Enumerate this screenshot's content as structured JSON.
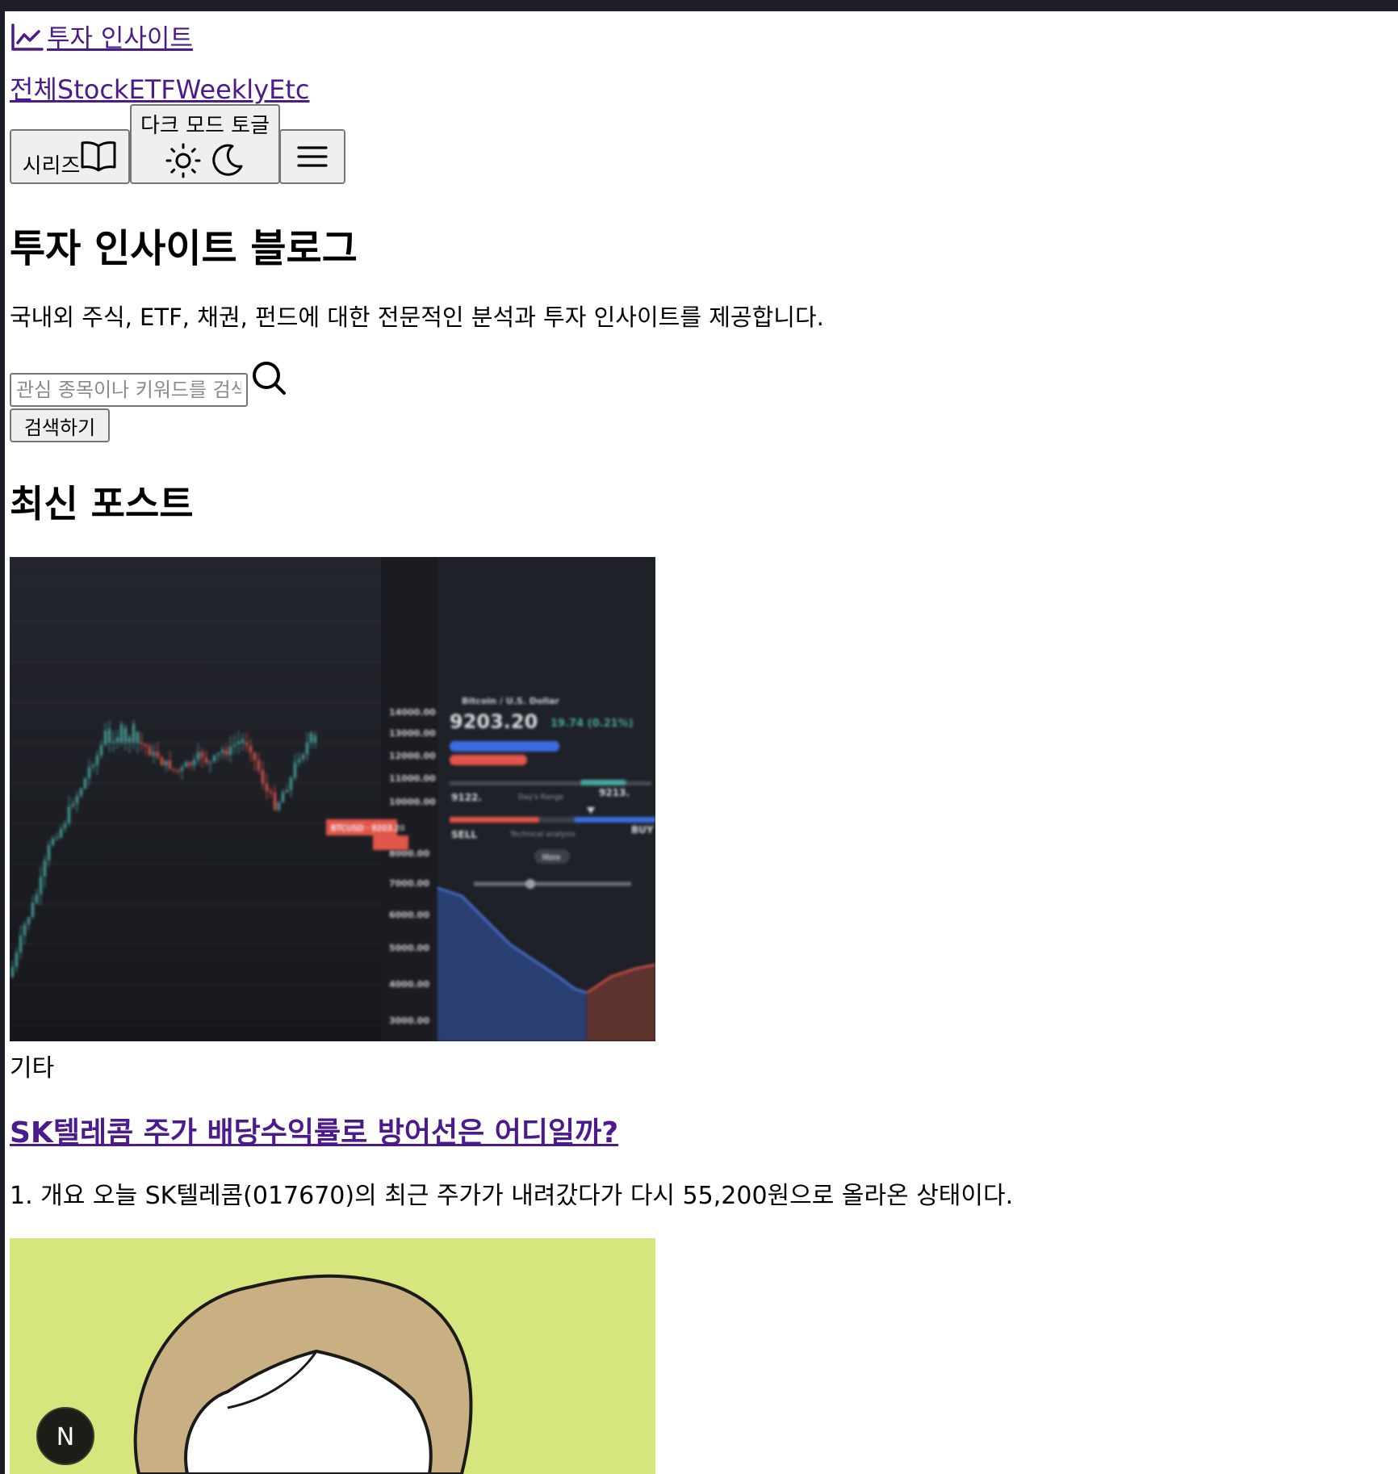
{
  "brand": {
    "title": "투자 인사이트"
  },
  "nav": {
    "items": [
      "전체",
      "Stock",
      "ETF",
      "Weekly",
      "Etc"
    ]
  },
  "toolbar": {
    "series_label": "시리즈",
    "theme_toggle_label": "다크 모드 토글"
  },
  "hero": {
    "title": "투자 인사이트 블로그",
    "description": "국내외 주식, ETF, 채권, 펀드에 대한 전문적인 분석과 투자 인사이트를 제공합니다."
  },
  "search": {
    "placeholder": "관심 종목이나 키워드를 검색",
    "button_label": "검색하기"
  },
  "section": {
    "title": "최신 포스트"
  },
  "posts": [
    {
      "category": "기타",
      "title": "SK텔레콤 주가 배당수익률로 방어선은 어디일까?",
      "excerpt": "1. 개요 오늘 SK텔레콤(017670)의 최근 주가가 내려갔다가 다시 55,200원으로 올라온 상태이다.",
      "image": {
        "header": "Bitcoin / U.S. Dollar",
        "price": "9203.20",
        "change": "19.74 (0.21%)",
        "badge": "BTCUSD · 9203.20",
        "range_low": "9122.",
        "range_high": "9213.",
        "sell_label": "SELL",
        "buy_label": "BUY",
        "range_label": "Day's Range",
        "tech_label": "Technical analysis",
        "more_label": "More",
        "price_ticks": [
          "14000.00",
          "13000.00",
          "12000.00",
          "11000.00",
          "10000.00",
          "8000.00",
          "7000.00",
          "6000.00",
          "5000.00",
          "4000.00",
          "3000.00"
        ]
      }
    }
  ],
  "colors": {
    "link": "#4b1a8c",
    "chart_bg": "#1b1d22",
    "candle_up": "#4aa6a0",
    "candle_down": "#e2554a",
    "thumb2_bg": "#d6e57c"
  },
  "next_badge": {
    "letter": "N"
  }
}
